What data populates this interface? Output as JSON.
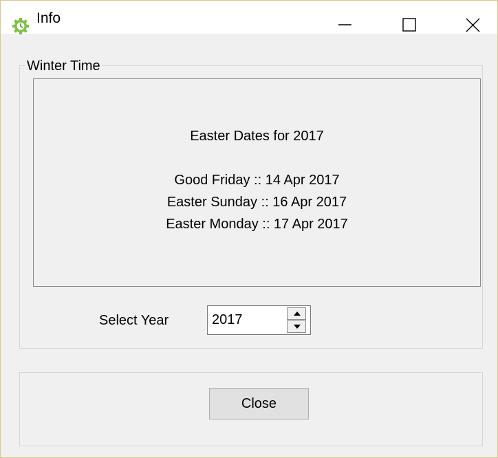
{
  "window": {
    "title": "Info",
    "icon": "clock-gear-icon",
    "icon_color": "#7cc242"
  },
  "controls": {
    "minimize_icon": "minimize-icon",
    "maximize_icon": "maximize-icon",
    "close_icon": "close-icon"
  },
  "group": {
    "title": "Winter Time"
  },
  "info": {
    "heading": "Easter Dates for 2017",
    "lines": [
      "Good Friday   :: 14 Apr 2017",
      "Easter Sunday :: 16 Apr 2017",
      "Easter Monday :: 17 Apr 2017"
    ]
  },
  "year_selector": {
    "label": "Select Year",
    "value": "2017"
  },
  "footer": {
    "close_label": "Close"
  }
}
